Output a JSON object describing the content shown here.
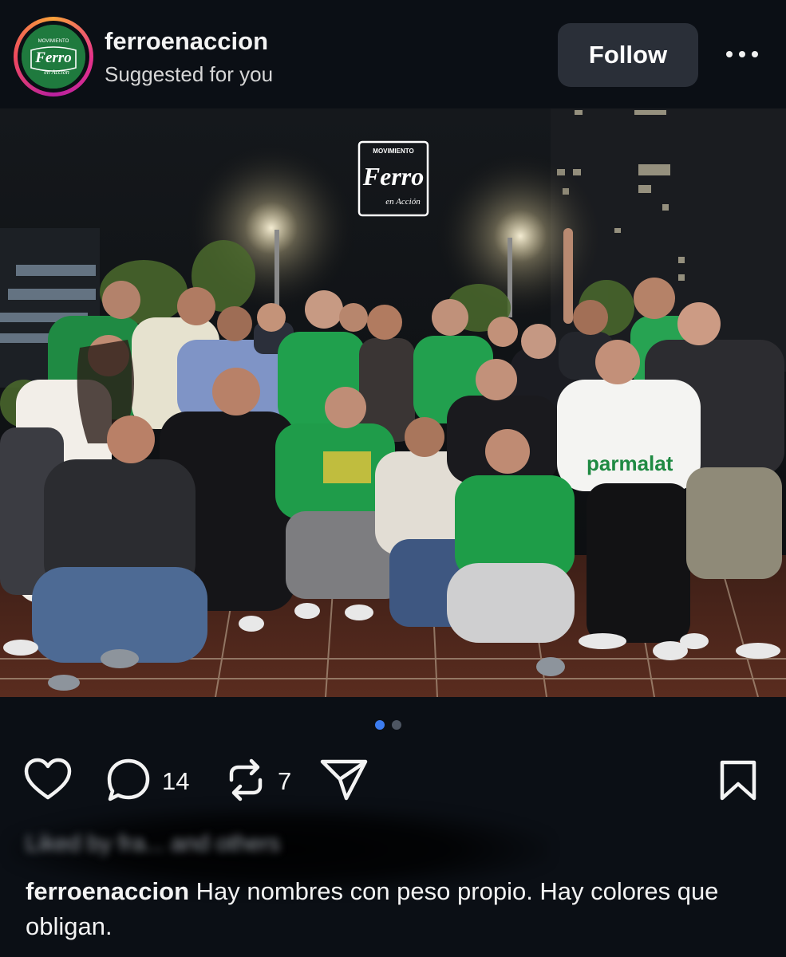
{
  "header": {
    "username": "ferroenaccion",
    "subtitle": "Suggested for you",
    "follow_label": "Follow",
    "avatar_logo_lines": [
      "MOVIMIENTO",
      "Ferro",
      "en Acción"
    ]
  },
  "photo": {
    "logo_lines": [
      "MOVIMIENTO",
      "Ferro",
      "en Acción"
    ],
    "jersey_text": "parmalat",
    "carousel": {
      "total": 2,
      "active": 1
    }
  },
  "actions": {
    "comments_count": "14",
    "reposts_count": "7"
  },
  "liked_by": "Liked by fra... and others",
  "caption": {
    "username": "ferroenaccion",
    "text": " Hay nombres con peso propio. Hay colores que obligan."
  },
  "colors": {
    "background": "#0b0f15",
    "follow_button": "#2a2f38",
    "carousel_active": "#3c7cf0",
    "ferro_green": "#1f7a3e"
  }
}
